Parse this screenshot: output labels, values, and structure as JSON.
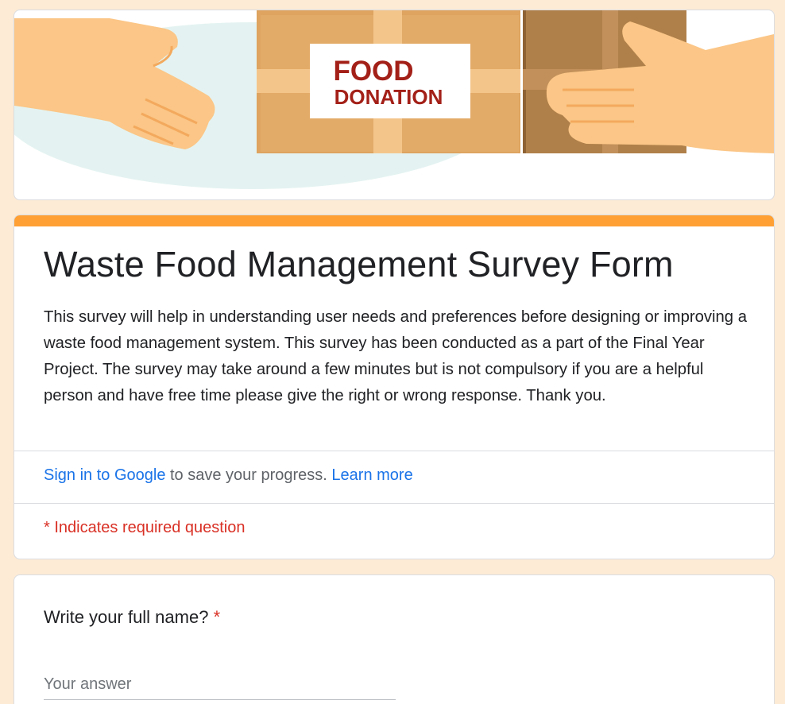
{
  "banner": {
    "line1": "FOOD",
    "line2": "DONATION"
  },
  "form": {
    "title": "Waste Food Management Survey Form",
    "description": "This survey will help in understanding user needs and preferences before designing or improving a waste food management system. This survey has been conducted as a part of the Final Year Project. The survey may take around a few minutes but is not compulsory if you are a helpful person and have free time please give the right or wrong response. Thank you."
  },
  "signin": {
    "link_text": "Sign in to Google",
    "middle_text": " to save your progress. ",
    "learn_more": "Learn more"
  },
  "required_note": "* Indicates required question",
  "question1": {
    "title": "Write your full name?",
    "required_mark": "*",
    "placeholder": "Your answer"
  },
  "colors": {
    "accent": "#ffa034",
    "link": "#1a73e8",
    "required": "#d93025",
    "background": "#fdebd6"
  }
}
